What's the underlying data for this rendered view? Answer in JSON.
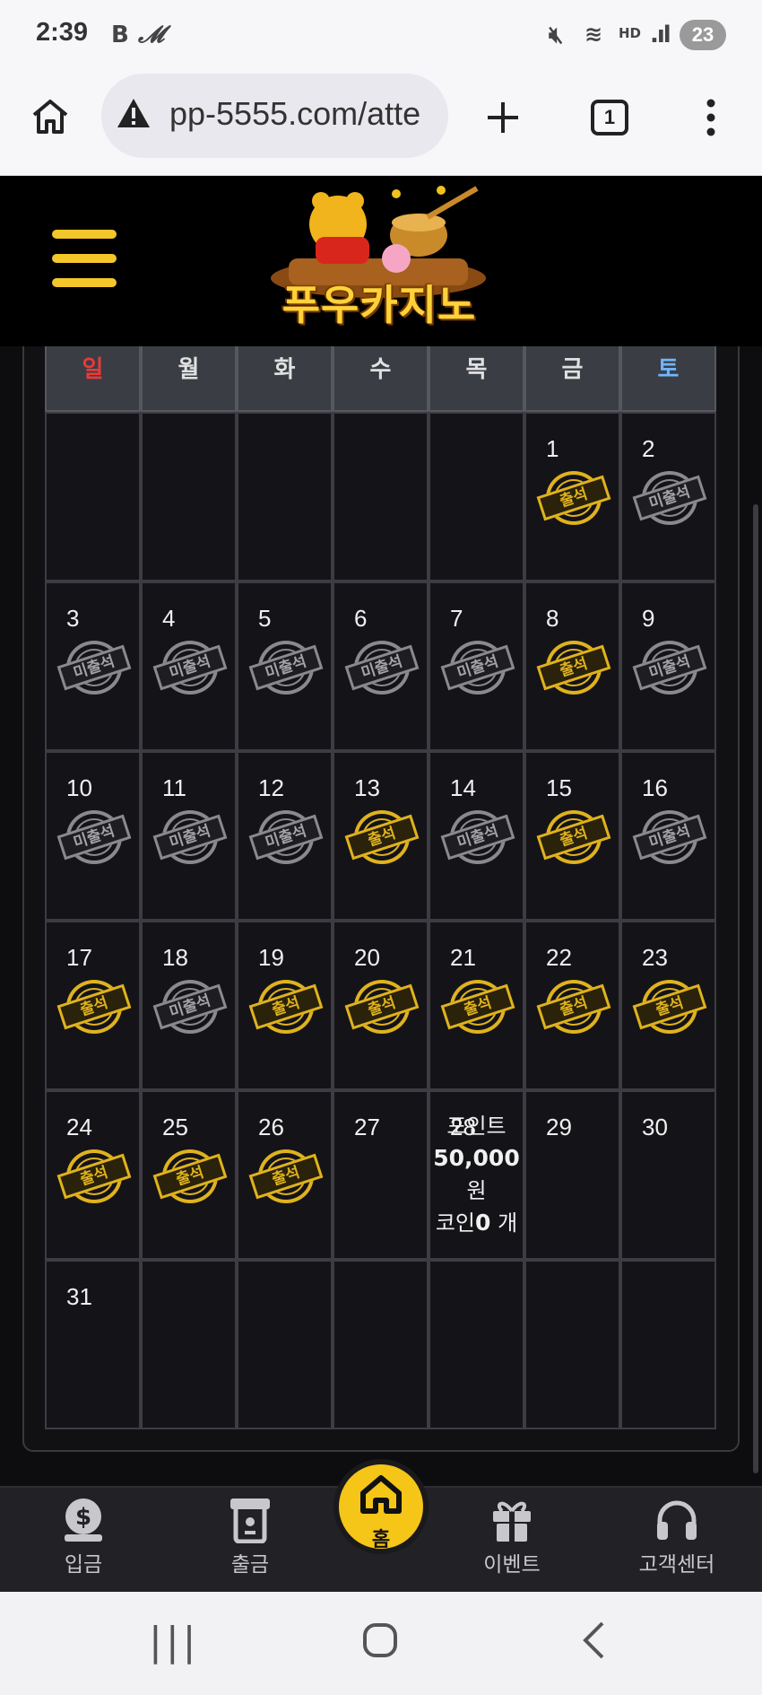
{
  "status_bar": {
    "time": "2:39",
    "left_icons": [
      "B",
      "M"
    ],
    "battery": "23"
  },
  "browser": {
    "url": "pp-5555.com/atte",
    "tab_count": "1"
  },
  "site": {
    "logo_text": "푸우카지노"
  },
  "calendar": {
    "weekdays": [
      "일",
      "월",
      "화",
      "수",
      "목",
      "금",
      "토"
    ],
    "stamp_present": "출석",
    "stamp_absent": "미출석",
    "weeks": [
      [
        null,
        null,
        null,
        null,
        null,
        {
          "day": "1",
          "stamp": "present"
        },
        {
          "day": "2",
          "stamp": "absent"
        }
      ],
      [
        {
          "day": "3",
          "stamp": "absent"
        },
        {
          "day": "4",
          "stamp": "absent"
        },
        {
          "day": "5",
          "stamp": "absent"
        },
        {
          "day": "6",
          "stamp": "absent"
        },
        {
          "day": "7",
          "stamp": "absent"
        },
        {
          "day": "8",
          "stamp": "present"
        },
        {
          "day": "9",
          "stamp": "absent"
        }
      ],
      [
        {
          "day": "10",
          "stamp": "absent"
        },
        {
          "day": "11",
          "stamp": "absent"
        },
        {
          "day": "12",
          "stamp": "absent"
        },
        {
          "day": "13",
          "stamp": "present"
        },
        {
          "day": "14",
          "stamp": "absent"
        },
        {
          "day": "15",
          "stamp": "present"
        },
        {
          "day": "16",
          "stamp": "absent"
        }
      ],
      [
        {
          "day": "17",
          "stamp": "present"
        },
        {
          "day": "18",
          "stamp": "absent"
        },
        {
          "day": "19",
          "stamp": "present"
        },
        {
          "day": "20",
          "stamp": "present"
        },
        {
          "day": "21",
          "stamp": "present"
        },
        {
          "day": "22",
          "stamp": "present"
        },
        {
          "day": "23",
          "stamp": "present"
        }
      ],
      [
        {
          "day": "24",
          "stamp": "present"
        },
        {
          "day": "25",
          "stamp": "present"
        },
        {
          "day": "26",
          "stamp": "present"
        },
        {
          "day": "27",
          "stamp": null
        },
        {
          "day": "28",
          "stamp": null,
          "today": true
        },
        {
          "day": "29",
          "stamp": null
        },
        {
          "day": "30",
          "stamp": null
        }
      ],
      [
        {
          "day": "31",
          "stamp": null
        },
        null,
        null,
        null,
        null,
        null,
        null
      ]
    ],
    "today_info": {
      "point_label": "포인트",
      "point_amount": "50,000",
      "point_unit": "원",
      "coin_label": "코인",
      "coin_amount": "0",
      "coin_unit": "개"
    }
  },
  "bottom_nav": {
    "deposit": "입금",
    "withdraw": "출금",
    "home": "홈",
    "event": "이벤트",
    "support": "고객센터"
  }
}
